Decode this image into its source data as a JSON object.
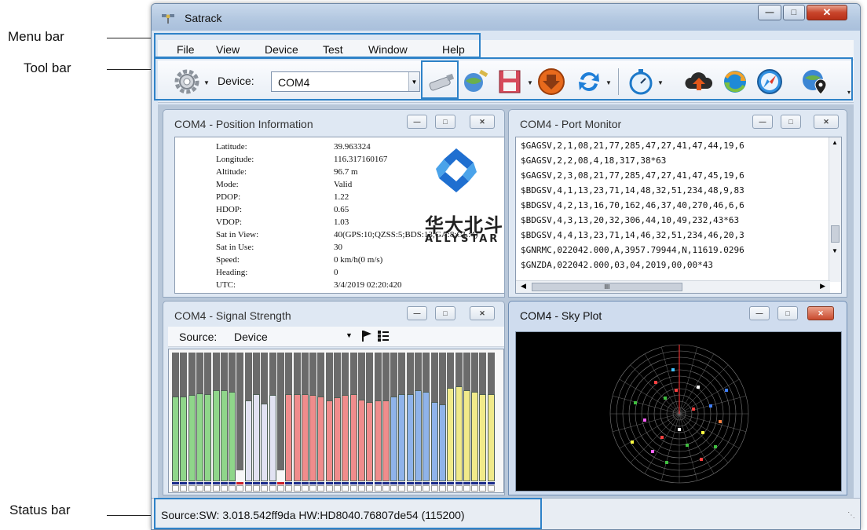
{
  "annotations": {
    "menu_bar": "Menu bar",
    "tool_bar": "Tool bar",
    "status_bar": "Status bar"
  },
  "window": {
    "title": "Satrack",
    "caption_buttons": [
      "minimize",
      "maximize",
      "close"
    ]
  },
  "menu": [
    "File",
    "View",
    "Device",
    "Test",
    "Window",
    "Help"
  ],
  "toolbar": {
    "device_label": "Device:",
    "device_value": "COM4",
    "icons": [
      "settings-gear-icon",
      "usb-stick-icon",
      "globe-satellite-icon",
      "save-disk-icon",
      "download-arrow-icon",
      "refresh-arrows-icon",
      "stopwatch-icon",
      "cloud-upload-icon",
      "sync-globe-icon",
      "compass-icon",
      "location-globe-icon"
    ]
  },
  "panels": {
    "position": {
      "title": "COM4 - Position Information",
      "rows": [
        {
          "label": "Latitude:",
          "value": "39.963324"
        },
        {
          "label": "Longitude:",
          "value": "116.317160167"
        },
        {
          "label": "Altitude:",
          "value": "96.7 m"
        },
        {
          "label": "Mode:",
          "value": "Valid"
        },
        {
          "label": "PDOP:",
          "value": "1.22"
        },
        {
          "label": "HDOP:",
          "value": "0.65"
        },
        {
          "label": "VDOP:",
          "value": "1.03"
        },
        {
          "label": "Sat in View:",
          "value": "40(GPS:10;QZSS:5;BDS:13;GA:8;GL:4)"
        },
        {
          "label": "Sat in Use:",
          "value": "30"
        },
        {
          "label": "Speed:",
          "value": "0 km/h(0 m/s)"
        },
        {
          "label": "Heading:",
          "value": "0"
        },
        {
          "label": "UTC:",
          "value": "3/4/2019 02:20:420"
        }
      ],
      "brand_cn": "华大北斗",
      "brand_en": "ALLYSTAR"
    },
    "port_monitor": {
      "title": "COM4 - Port Monitor",
      "lines": [
        "$GAGSV,2,1,08,21,77,285,47,27,41,47,44,19,6",
        "$GAGSV,2,2,08,4,18,317,38*63",
        "$GAGSV,2,3,08,21,77,285,47,27,41,47,45,19,6",
        "$BDGSV,4,1,13,23,71,14,48,32,51,234,48,9,83",
        "$BDGSV,4,2,13,16,70,162,46,37,40,270,46,6,6",
        "$BDGSV,4,3,13,20,32,306,44,10,49,232,43*63",
        "$BDGSV,4,4,13,23,71,14,46,32,51,234,46,20,3",
        "$GNRMC,022042.000,A,3957.79944,N,11619.0296",
        "$GNZDA,022042.000,03,04,2019,00,00*43"
      ],
      "hscroll_mark": "III"
    },
    "signal": {
      "title": "COM4 - Signal Strength",
      "source_label": "Source:",
      "source_value": "Device",
      "bars": [
        {
          "level": 0.84,
          "color": "#8fd68a"
        },
        {
          "level": 0.84,
          "color": "#8fd68a"
        },
        {
          "level": 0.85,
          "color": "#8fd68a"
        },
        {
          "level": 0.87,
          "color": "#8fd68a"
        },
        {
          "level": 0.86,
          "color": "#8fd68a"
        },
        {
          "level": 0.9,
          "color": "#8fd68a"
        },
        {
          "level": 0.9,
          "color": "#8fd68a"
        },
        {
          "level": 0.88,
          "color": "#8fd68a"
        },
        {
          "level": 0.0,
          "color": "#e8e8ee"
        },
        {
          "level": 0.8,
          "color": "#e2e2f2"
        },
        {
          "level": 0.86,
          "color": "#e2e2f2"
        },
        {
          "level": 0.77,
          "color": "#e2e2f2"
        },
        {
          "level": 0.85,
          "color": "#e2e2f2"
        },
        {
          "level": 0.0,
          "color": "#e8e8ee"
        },
        {
          "level": 0.86,
          "color": "#f08c8c"
        },
        {
          "level": 0.86,
          "color": "#f08c8c"
        },
        {
          "level": 0.86,
          "color": "#f08c8c"
        },
        {
          "level": 0.85,
          "color": "#f08c8c"
        },
        {
          "level": 0.84,
          "color": "#f08c8c"
        },
        {
          "level": 0.8,
          "color": "#f08c8c"
        },
        {
          "level": 0.83,
          "color": "#f08c8c"
        },
        {
          "level": 0.85,
          "color": "#f08c8c"
        },
        {
          "level": 0.86,
          "color": "#f08c8c"
        },
        {
          "level": 0.81,
          "color": "#f08c8c"
        },
        {
          "level": 0.78,
          "color": "#f08c8c"
        },
        {
          "level": 0.8,
          "color": "#f08c8c"
        },
        {
          "level": 0.8,
          "color": "#f08c8c"
        },
        {
          "level": 0.84,
          "color": "#8fb3ea"
        },
        {
          "level": 0.86,
          "color": "#8fb3ea"
        },
        {
          "level": 0.86,
          "color": "#8fb3ea"
        },
        {
          "level": 0.9,
          "color": "#8fb3ea"
        },
        {
          "level": 0.88,
          "color": "#8fb3ea"
        },
        {
          "level": 0.78,
          "color": "#8fb3ea"
        },
        {
          "level": 0.76,
          "color": "#8fb3ea"
        },
        {
          "level": 0.92,
          "color": "#f1ea8a"
        },
        {
          "level": 0.94,
          "color": "#f1ea8a"
        },
        {
          "level": 0.9,
          "color": "#f1ea8a"
        },
        {
          "level": 0.88,
          "color": "#f1ea8a"
        },
        {
          "level": 0.86,
          "color": "#f1ea8a"
        },
        {
          "level": 0.86,
          "color": "#f1ea8a"
        }
      ]
    },
    "sky": {
      "title": "COM4 - Sky Plot"
    }
  },
  "statusbar": {
    "text": "Source:SW: 3.018.542ff9da   HW:HD8040.76807de54   (115200)"
  },
  "colors": {
    "highlight": "#2e82c8",
    "sky_background": "#000000"
  }
}
